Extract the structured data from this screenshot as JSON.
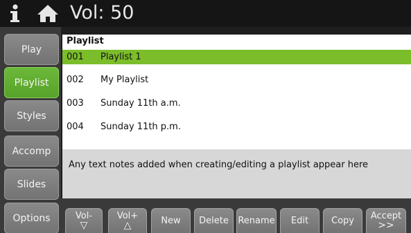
{
  "header": {
    "volume_label": "Vol: 50",
    "info_icon": "info-icon",
    "home_icon": "home-icon"
  },
  "sidebar": {
    "tabs": [
      {
        "label": "Play",
        "active": false
      },
      {
        "label": "Playlist",
        "active": true
      },
      {
        "label": "Styles",
        "active": false
      },
      {
        "label": "Accomp",
        "active": false
      },
      {
        "label": "Slides",
        "active": false
      },
      {
        "label": "Options",
        "active": false
      }
    ]
  },
  "playlist": {
    "title": "Playlist",
    "rows": [
      {
        "num": "001",
        "name": "Playlist 1",
        "selected": true
      },
      {
        "num": "002",
        "name": "My Playlist",
        "selected": false
      },
      {
        "num": "003",
        "name": "Sunday 11th a.m.",
        "selected": false
      },
      {
        "num": "004",
        "name": "Sunday 11th p.m.",
        "selected": false
      }
    ]
  },
  "notes": {
    "text": "Any text notes added when creating/editing a playlist appear here"
  },
  "buttons": {
    "vol_down": {
      "label": "Vol-",
      "sub": "▽"
    },
    "vol_up": {
      "label": "Vol+",
      "sub": "△"
    },
    "new": "New",
    "delete": "Delete",
    "rename": "Rename",
    "edit": "Edit",
    "copy": "Copy",
    "accept": {
      "label": "Accept",
      "sub": ">>"
    }
  },
  "colors": {
    "accent_green": "#7bbd2a",
    "tab_grey": "#7d7d7d",
    "background": "#1e1e1e"
  }
}
